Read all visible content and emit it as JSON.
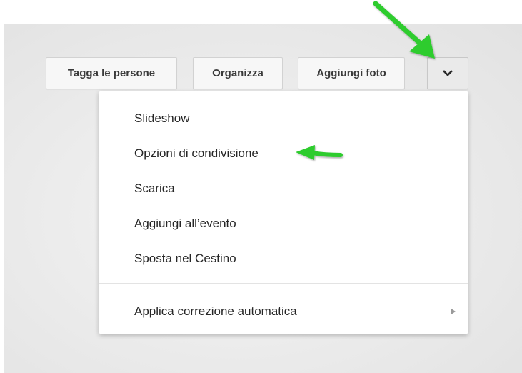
{
  "toolbar": {
    "tag_label": "Tagga le persone",
    "organize_label": "Organizza",
    "add_photo_label": "Aggiungi foto",
    "more_icon": "chevron-down-icon"
  },
  "menu": {
    "items": [
      {
        "label": "Slideshow"
      },
      {
        "label": "Opzioni di condivisione"
      },
      {
        "label": "Scarica"
      },
      {
        "label": "Aggiungi all’evento"
      },
      {
        "label": "Sposta nel Cestino"
      },
      {
        "label": "Applica correzione automatica",
        "has_submenu": true
      }
    ]
  },
  "annotations": {
    "arrow_color": "#2ecc2e",
    "arrows": [
      "arrow-to-more-button",
      "arrow-to-sharing-options"
    ]
  },
  "colors": {
    "panel_background": "#e8e8e8",
    "menu_background": "#ffffff",
    "text": "#262626"
  }
}
